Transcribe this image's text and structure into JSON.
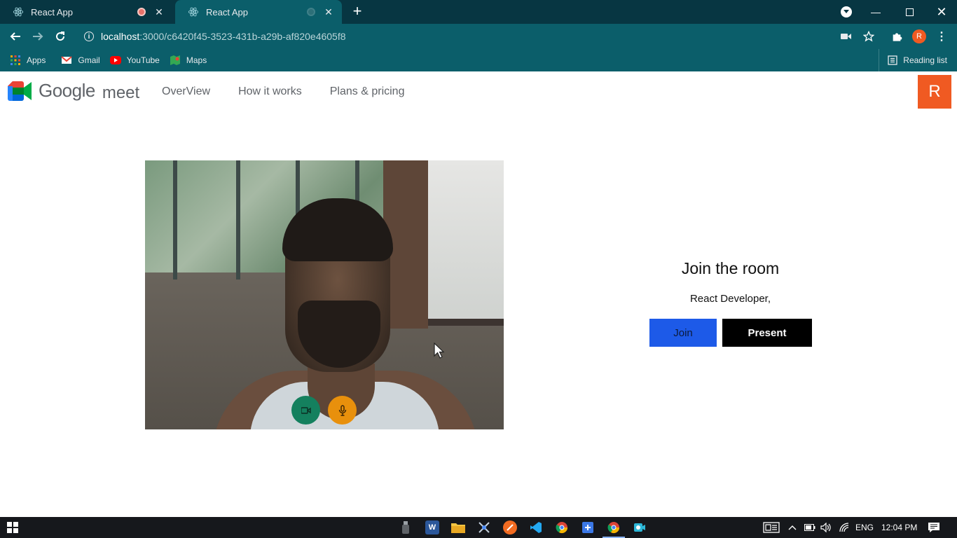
{
  "browser": {
    "tabs": [
      {
        "title": "React App",
        "active": false
      },
      {
        "title": "React App",
        "active": true
      }
    ],
    "new_tab": "+",
    "url": {
      "host": "localhost",
      "path": ":3000/c6420f45-3523-431b-a29b-af820e4605f8"
    },
    "profile_initial": "R",
    "bookmarks": [
      {
        "label": "Apps",
        "icon": "apps-grid-icon"
      },
      {
        "label": "Gmail",
        "icon": "gmail-icon"
      },
      {
        "label": "YouTube",
        "icon": "youtube-icon"
      },
      {
        "label": "Maps",
        "icon": "maps-icon"
      }
    ],
    "reading_list": "Reading list"
  },
  "app": {
    "logo": {
      "google": "Google",
      "meet": "meet"
    },
    "nav": [
      {
        "label": "OverView"
      },
      {
        "label": "How it works"
      },
      {
        "label": "Plans & pricing"
      }
    ],
    "user_initial": "R",
    "join": {
      "title": "Join the room",
      "subtitle": "React Developer,",
      "join_label": "Join",
      "present_label": "Present"
    },
    "colors": {
      "accent_orange": "#f05a22",
      "join_blue": "#1d5ae8",
      "cam_green": "#14805e",
      "mic_orange": "#e8900c"
    }
  },
  "taskbar": {
    "language": "ENG",
    "time": "12:04 PM"
  }
}
